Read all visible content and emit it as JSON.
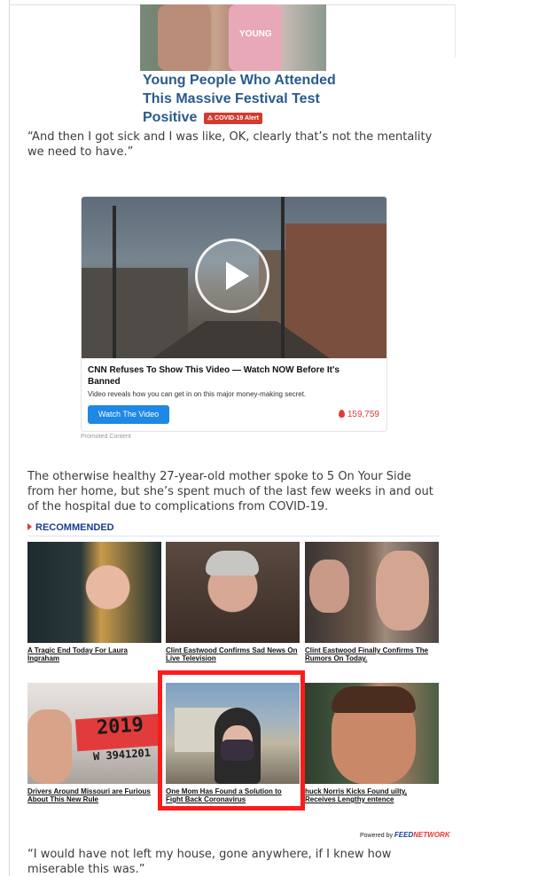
{
  "top_story": {
    "title": "Young People Who Attended This Massive Festival Test Positive",
    "badge": "⚠ COVID-19 Alert",
    "thumb_text": "YOUNG"
  },
  "article": {
    "quote_1": "“And then I got sick and I was like, OK, clearly that’s not the mentality we need to have.”",
    "paragraph_2": "The otherwise healthy 27-year-old mother spoke to 5 On Your Side from her home, but she’s spent much of the last few weeks in and out of the hospital due to complications from COVID-19.",
    "quote_3": "“I would have not left my house, gone anywhere, if I knew how miserable this was.”"
  },
  "ad": {
    "headline": "CNN Refuses To Show This Video — Watch NOW Before It's Banned",
    "description": "Video reveals how you can get in on this major money-making secret.",
    "button_label": "Watch The Video",
    "count": "159,759",
    "promoted_label": "Promoted Content"
  },
  "recommended": {
    "heading": "RECOMMENDED",
    "items": [
      {
        "caption": "A Tragic End Today For Laura Ingraham"
      },
      {
        "caption": "Clint Eastwood Confirms Sad News On Live Television"
      },
      {
        "caption": "Clint Eastwood Finally Confirms The Rumors On Today."
      },
      {
        "caption": "Drivers Around Missouri are Furious About This New Rule",
        "plate_year": "2019",
        "plate_number": "W 3941201"
      },
      {
        "caption": "One Mom Has Found a Solution to Fight Back Coronavirus"
      },
      {
        "caption": "huck Norris Kicks Found uilty, Receives Lengthy entence"
      }
    ],
    "powered_by": "Powered by",
    "powered_brand_1": "FEED",
    "powered_brand_2": "NETWORK"
  },
  "colors": {
    "link_blue": "#2a5a8c",
    "accent_red": "#e53935",
    "button_blue": "#1e88e5",
    "highlight_red": "#ff1a1a"
  }
}
